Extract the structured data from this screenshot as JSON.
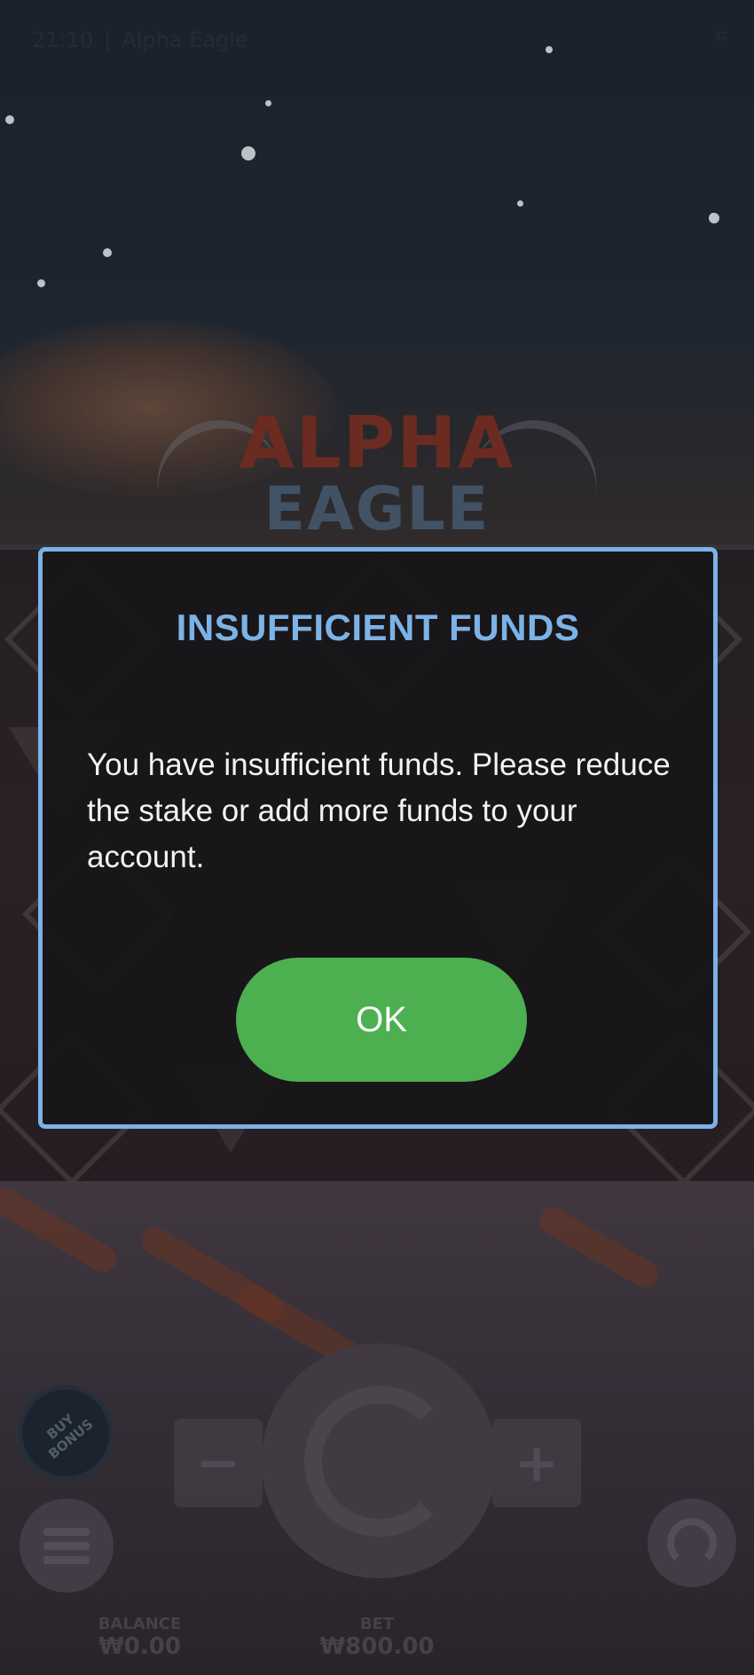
{
  "status_bar": {
    "time": "21:10",
    "separator": "|",
    "app_title": "Alpha Eagle"
  },
  "game": {
    "logo_line1": "ALPHA",
    "logo_line2": "EAGLE",
    "buy_bonus_label": "BUY BONUS",
    "decrease_label": "−",
    "increase_label": "+",
    "balance_label": "BALANCE",
    "balance_value": "₩0.00",
    "bet_label": "BET",
    "bet_value": "₩800.00"
  },
  "dialog": {
    "title": "INSUFFICIENT FUNDS",
    "message": "You have insufficient funds. Please reduce the stake or add more funds to your account.",
    "ok_label": "OK"
  },
  "colors": {
    "dialog_border": "#7cb2e6",
    "title": "#7cb2e6",
    "ok_button": "#4caf50",
    "dialog_background": "#181618"
  }
}
